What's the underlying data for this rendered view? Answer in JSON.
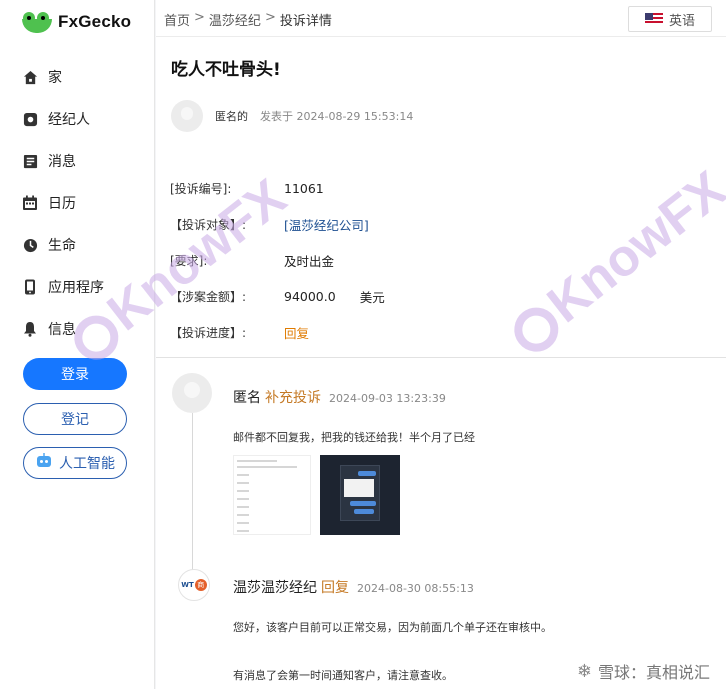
{
  "app": {
    "name": "FxGecko"
  },
  "sidebar": {
    "items": [
      {
        "label": "家",
        "icon": "home-icon"
      },
      {
        "label": "经纪人",
        "icon": "broker-icon"
      },
      {
        "label": "消息",
        "icon": "news-icon"
      },
      {
        "label": "日历",
        "icon": "calendar-icon"
      },
      {
        "label": "生命",
        "icon": "life-icon"
      },
      {
        "label": "应用程序",
        "icon": "mobile-app-icon"
      },
      {
        "label": "信息",
        "icon": "bell-icon"
      }
    ],
    "login_label": "登录",
    "register_label": "登记",
    "ai_label": "人工智能"
  },
  "breadcrumb": {
    "home": "首页",
    "broker": "温莎经纪",
    "current": "投诉详情",
    "sep": ">"
  },
  "language": {
    "label": "英语",
    "flag": "us-flag-icon"
  },
  "complaint": {
    "title": "吃人不吐骨头!",
    "author": "匿名的",
    "posted": "发表于 2024-08-29 15:53:14",
    "fields": {
      "id_label": "[投诉编号]:",
      "id_value": "11061",
      "target_label": "【投诉对象】:",
      "target_value": "[温莎经纪公司]",
      "request_label": "[要求]:",
      "request_value": "及时出金",
      "amount_label": "【涉案金额】:",
      "amount_value": "94000.0",
      "amount_unit": "美元",
      "progress_label": "【投诉进度】:",
      "progress_value": "回复"
    }
  },
  "replies": [
    {
      "name": "匿名",
      "type": "补充投诉",
      "time": "2024-09-03 13:23:39",
      "text": "邮件都不回复我，把我的钱还给我！半个月了已经"
    },
    {
      "name": "温莎温莎经纪",
      "type": "回复",
      "time": "2024-08-30 08:55:13",
      "text": "您好，该客户目前可以正常交易，因为前面几个单子还在审核中。",
      "text2": "有消息了会第一时间通知客户，请注意查收。",
      "logo_text": "WT",
      "badge": "商"
    }
  ],
  "watermark": {
    "text": "KnowFX",
    "footer": "雪球：真相说汇"
  },
  "colors": {
    "primary": "#1677ff",
    "reply_orange": "#c57a26",
    "link_blue": "#1d4f91",
    "progress_orange": "#e07b00"
  }
}
